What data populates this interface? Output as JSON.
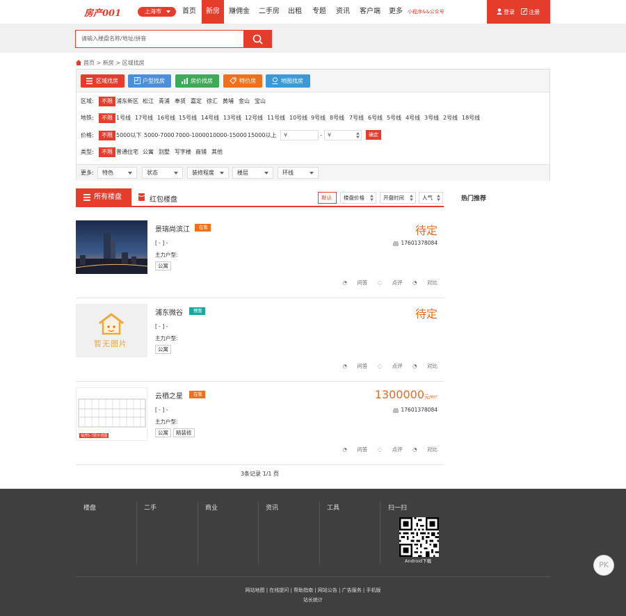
{
  "header": {
    "logo": "房产001",
    "city": "上海市",
    "nav": [
      "首页",
      "新房",
      "赚佣金",
      "二手房",
      "出租",
      "专题",
      "资讯",
      "客户端",
      "更多"
    ],
    "active_nav": "新房",
    "mini": "小程序&&公众号",
    "login": "登录",
    "register": "注册"
  },
  "search": {
    "placeholder": "请输入楼盘名称/地址/拼音"
  },
  "breadcrumb": "首页 > 新房 > 区域找房",
  "find_tabs": [
    {
      "label": "区域找房",
      "color": "#e53c2b"
    },
    {
      "label": "户型找房",
      "color": "#4a8fdb"
    },
    {
      "label": "房价找房",
      "color": "#3daa58"
    },
    {
      "label": "特价房",
      "color": "#f0701c"
    },
    {
      "label": "地图找房",
      "color": "#3a9ad9"
    }
  ],
  "filters": {
    "area_label": "区域:",
    "area": [
      "不限",
      "浦东新区",
      "松江",
      "青浦",
      "奉贤",
      "嘉定",
      "徐汇",
      "黄埔",
      "金山",
      "宝山"
    ],
    "metro_label": "地铁:",
    "metro": [
      "不限",
      "1号线",
      "17号线",
      "16号线",
      "15号线",
      "14号线",
      "13号线",
      "12号线",
      "11号线",
      "10号线",
      "9号线",
      "8号线",
      "7号线",
      "6号线",
      "5号线",
      "4号线",
      "3号线",
      "2号线",
      "18号线"
    ],
    "price_label": "价格:",
    "price": [
      "不限",
      "5000以下",
      "5000-7000",
      "7000-10000",
      "10000-15000",
      "15000以上"
    ],
    "price_min_placeholder": "¥",
    "price_max_placeholder": "¥",
    "price_dash": "-",
    "confirm": "确定",
    "type_label": "类型:",
    "type": [
      "不限",
      "普通住宅",
      "公寓",
      "别墅",
      "写字楼",
      "商铺",
      "其他"
    ],
    "more_label": "更多:",
    "more": [
      "特色",
      "状态",
      "装修程度",
      "楼层",
      "环线"
    ]
  },
  "list": {
    "tab_all": "所有楼盘",
    "tab_red": "红包楼盘",
    "sort": [
      "默认",
      "楼盘价格",
      "开盘时间",
      "人气"
    ],
    "hot_title": "热门推荐",
    "items": [
      {
        "name": "景瑞尚滨江",
        "status": "在售",
        "status_color": "#f0701c",
        "address": "[ - ] -",
        "type_line": "主力户型:",
        "tags": [
          "公寓"
        ],
        "price": "待定",
        "unit": "",
        "phone": "17601378084",
        "actions": [
          "问答",
          "点评",
          "对比"
        ]
      },
      {
        "name": "浦东微谷",
        "status": "预售",
        "status_color": "#1aa89c",
        "address": "[ - ] -",
        "type_line": "主力户型:",
        "tags": [
          "公寓"
        ],
        "price": "待定",
        "unit": "",
        "phone": "",
        "actions": [
          "问答",
          "点评",
          "对比"
        ],
        "placeholder_img": "暂无图片"
      },
      {
        "name": "云栖之星",
        "status": "在售",
        "status_color": "#f0701c",
        "address": "[ - ] -",
        "type_line": "主力户型:",
        "tags": [
          "公寓",
          "精装修"
        ],
        "price": "1300000",
        "unit": "元/m²",
        "phone": "17601378084",
        "actions": [
          "问答",
          "点评",
          "对比"
        ],
        "img_caption": "铂湾5-7层示范图"
      }
    ],
    "pager": "3条记录 1/1 页"
  },
  "footer": {
    "cols": [
      "楼盘",
      "二手",
      "商业",
      "资讯",
      "工具",
      "扫一扫"
    ],
    "qr_label": "Android下载",
    "links": "网站地图 | 在线提问 | 帮助指南 | 网站公告 | 广告服务 | 手机版",
    "stat": "站长统计",
    "pk": "PK"
  },
  "colors": {
    "accent": "#e53c2b",
    "price": "#e86a1c",
    "footer_bg": "#3f3f3f"
  }
}
